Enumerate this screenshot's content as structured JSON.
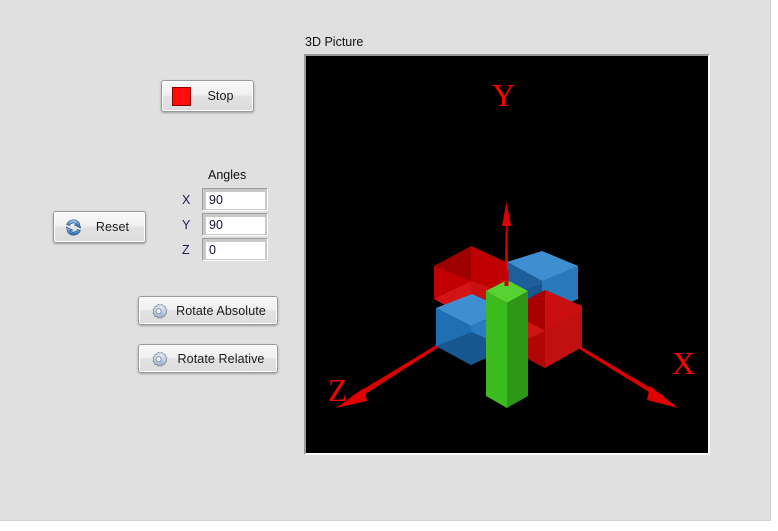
{
  "window": {
    "background_color": "#e0e0e0",
    "panel_color": "#e0e0e0"
  },
  "controls": {
    "stop_button": {
      "label": "Stop",
      "icon": "stop-square-icon",
      "icon_color": "#ff0c0c"
    },
    "reset_button": {
      "label": "Reset",
      "icon": "refresh-circular-arrows-icon",
      "icon_color": "#4a80c0"
    },
    "rotate_absolute_button": {
      "label": "Rotate Absolute",
      "icon": "gear-icon",
      "icon_color": "#b8c4dc"
    },
    "rotate_relative_button": {
      "label": "Rotate Relative",
      "icon": "gear-icon",
      "icon_color": "#b8c4dc"
    }
  },
  "angles": {
    "title": "Angles",
    "rows": [
      {
        "label": "X",
        "value": "90"
      },
      {
        "label": "Y",
        "value": "90"
      },
      {
        "label": "Z",
        "value": "0"
      }
    ]
  },
  "picture": {
    "label": "3D Picture",
    "background_color": "#000000",
    "axes": {
      "color": "#ff0000",
      "labels": [
        {
          "name": "Y",
          "direction": "up"
        },
        {
          "name": "X",
          "direction": "down-right"
        },
        {
          "name": "Z",
          "direction": "down-left"
        }
      ]
    },
    "objects": {
      "green_box_color": "#3cbb1e",
      "red_box_color": "#cc0d0d",
      "blue_box_color": "#1f6fb5"
    }
  }
}
